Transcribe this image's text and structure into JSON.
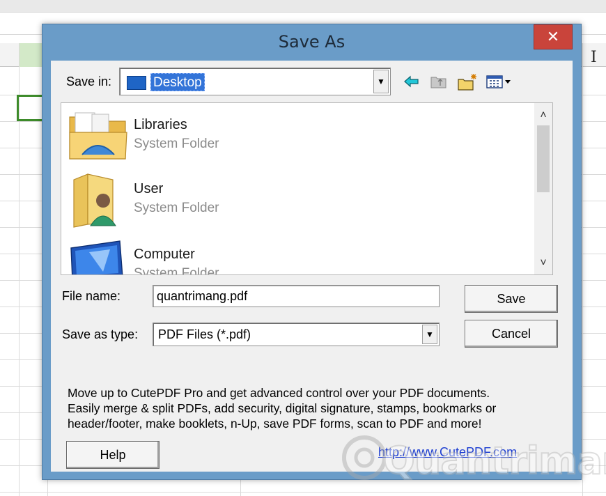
{
  "dialog": {
    "title": "Save As",
    "close_label": "✕",
    "save_in": {
      "label": "Save in:",
      "value": "Desktop"
    },
    "toolbar": {
      "back_icon": "back-arrow-icon",
      "up_folder_icon": "up-folder-icon",
      "new_folder_icon": "new-folder-icon",
      "view_menu_icon": "view-menu-icon"
    },
    "items": [
      {
        "name": "Libraries",
        "type": "System Folder",
        "icon": "libraries-icon"
      },
      {
        "name": "User",
        "type": "System Folder",
        "icon": "user-folder-icon"
      },
      {
        "name": "Computer",
        "type": "System Folder",
        "icon": "computer-icon"
      }
    ],
    "file_name": {
      "label": "File name:",
      "value": "quantrimang.pdf"
    },
    "save_as_type": {
      "label": "Save as type:",
      "value": "PDF Files (*.pdf)"
    },
    "buttons": {
      "save": "Save",
      "cancel": "Cancel",
      "help": "Help"
    },
    "promo_lines": [
      "Move up to CutePDF Pro and get advanced control over your PDF documents.",
      "Easily merge & split PDFs, add security, digital signature, stamps, bookmarks or",
      "header/footer, make booklets, n-Up, save PDF forms, scan to PDF and more!"
    ],
    "link": "http://www.CutePDF.com"
  },
  "watermark": "Quantrimang",
  "colors": {
    "title_bar": "#6a9cc8",
    "close_button": "#c9443b",
    "selection": "#3374d8",
    "link": "#1e3fd1"
  }
}
